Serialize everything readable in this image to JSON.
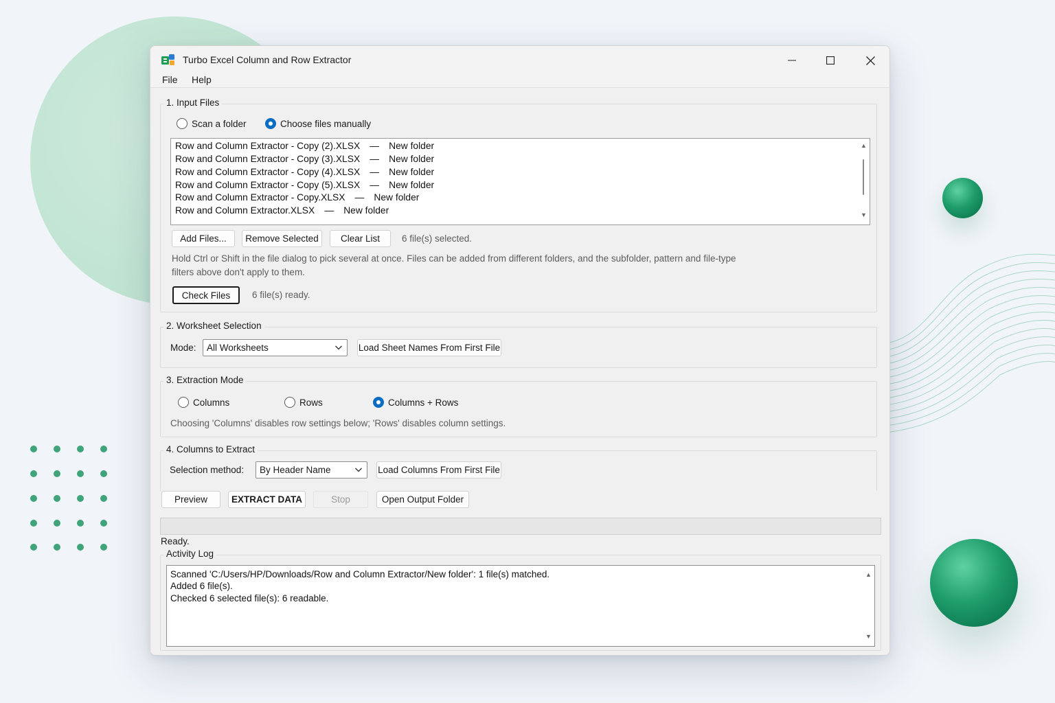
{
  "window": {
    "title": "Turbo Excel Column and Row Extractor"
  },
  "menu": [
    "File",
    "Help"
  ],
  "input_files": {
    "title": "1. Input Files",
    "scan_folder_label": "Scan a folder",
    "choose_manual_label": "Choose files manually",
    "selected_mode": "Choose files manually",
    "files": [
      {
        "name": "Row and Column Extractor - Copy (2).XLSX",
        "sep": "—",
        "folder": "New folder"
      },
      {
        "name": "Row and Column Extractor - Copy (3).XLSX",
        "sep": "—",
        "folder": "New folder"
      },
      {
        "name": "Row and Column Extractor - Copy (4).XLSX",
        "sep": "—",
        "folder": "New folder"
      },
      {
        "name": "Row and Column Extractor - Copy (5).XLSX",
        "sep": "—",
        "folder": "New folder"
      },
      {
        "name": "Row and Column Extractor - Copy.XLSX",
        "sep": "—",
        "folder": "New folder"
      },
      {
        "name": "Row and Column Extractor.XLSX",
        "sep": "—",
        "folder": "New folder"
      }
    ],
    "add_files_label": "Add Files...",
    "remove_selected_label": "Remove Selected",
    "clear_list_label": "Clear List",
    "selected_count": "6 file(s) selected.",
    "hint_line1": "Hold Ctrl or Shift in the file dialog to pick several at once. Files can be added from different folders, and the subfolder, pattern and file-type",
    "hint_line2": "filters above don't apply to them.",
    "check_files_label": "Check Files",
    "ready_count": "6 file(s) ready."
  },
  "worksheet": {
    "title": "2. Worksheet Selection",
    "mode_label": "Mode:",
    "mode_value": "All Worksheets",
    "load_sheets_label": "Load Sheet Names From First File"
  },
  "extraction": {
    "title": "3. Extraction Mode",
    "columns_label": "Columns",
    "rows_label": "Rows",
    "both_label": "Columns + Rows",
    "selected": "Columns + Rows",
    "hint": "Choosing 'Columns' disables row settings below; 'Rows' disables column settings."
  },
  "columns": {
    "title": "4. Columns to Extract",
    "method_label": "Selection method:",
    "method_value": "By Header Name",
    "load_columns_label": "Load Columns From First File"
  },
  "actions": {
    "preview_label": "Preview",
    "extract_label": "EXTRACT DATA",
    "stop_label": "Stop",
    "open_output_label": "Open Output Folder"
  },
  "status": {
    "text": "Ready.",
    "progress": 0
  },
  "log": {
    "title": "Activity Log",
    "lines": [
      "Scanned 'C:/Users/HP/Downloads/Row and Column Extractor/New folder': 1 file(s) matched.",
      "Added 6 file(s).",
      "Checked 6 selected file(s): 6 readable."
    ]
  },
  "colors": {
    "accent": "#0a6cc2",
    "sphere_green": "#1f9d6b",
    "dot_green": "#3fa47a"
  }
}
